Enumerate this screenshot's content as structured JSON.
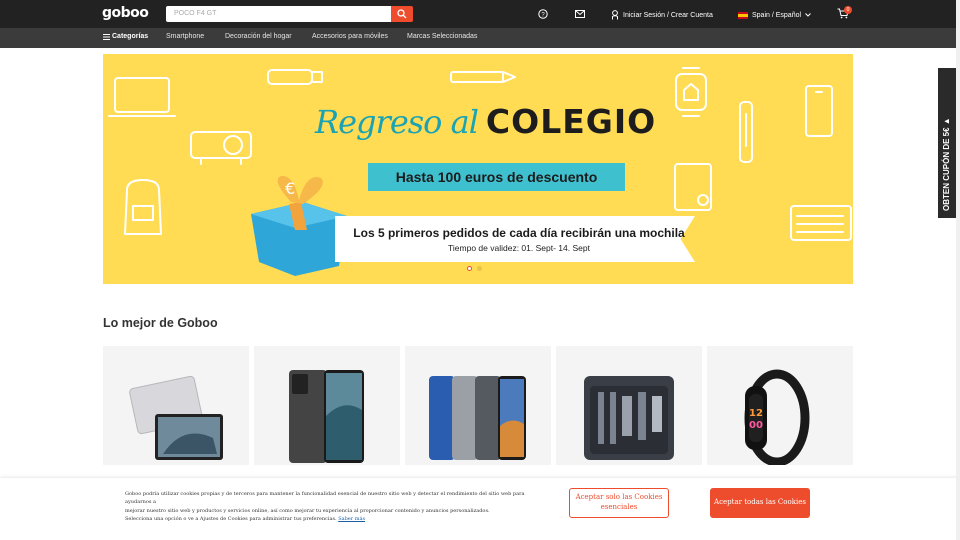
{
  "header": {
    "logo": "goboo",
    "search_placeholder": "POCO F4 GT",
    "login_label": "Iniciar Sesión / Crear Cuenta",
    "language_label": "Spain / Español",
    "cart_count": "0",
    "icons": [
      "search-icon",
      "help-icon",
      "mail-icon",
      "user-icon",
      "flag-spain-icon",
      "chevron-down-icon",
      "cart-icon"
    ]
  },
  "nav": {
    "categories_label": "Categorías",
    "items": [
      "Smartphone",
      "Decoración del hogar",
      "Accesorios para móviles",
      "Marcas Seleccionadas"
    ]
  },
  "banner": {
    "headline_script": "Regreso al",
    "headline_bold": "COLEGIO",
    "discount": "Hasta 100 euros de descuento",
    "ribbon_main": "Los 5 primeros pedidos de cada día recibirán una mochila",
    "ribbon_sub": "Tiempo de validez: 01. Sept- 14. Sept",
    "slides": 2,
    "active_slide": 1
  },
  "coupon": {
    "label": "OBTEN CUPÓN DE 5€ ▲"
  },
  "section": {
    "title": "Lo mejor de Goboo",
    "products": [
      "tablet-image",
      "phone-image",
      "phones-lineup-image",
      "toolkit-image",
      "smartband-image"
    ]
  },
  "cookies": {
    "line1": "Goboo podría utilizar cookies propias y de terceros para mantener la funcionalidad esencial de nuestro sitio web y detectar el rendimiento del sitio web para ayudarnos a",
    "line2": "mejorar nuestro sitio web y productos y servicios online, así como mejorar tu experiencia al proporcionar contenido y anuncios personalizados.",
    "line3": "Selecciona una opción o ve a Ajustes de Cookies para administrar tus preferencias.",
    "link": "Saber más",
    "btn_essential": "Aceptar solo las Cookies esenciales",
    "btn_all": "Aceptar todas las Cookies"
  },
  "colors": {
    "accent": "#ee4d2d",
    "banner": "#ffdc54",
    "teal": "#3fc0cf",
    "topbar": "#222222",
    "navbar": "#3b3b3b"
  }
}
